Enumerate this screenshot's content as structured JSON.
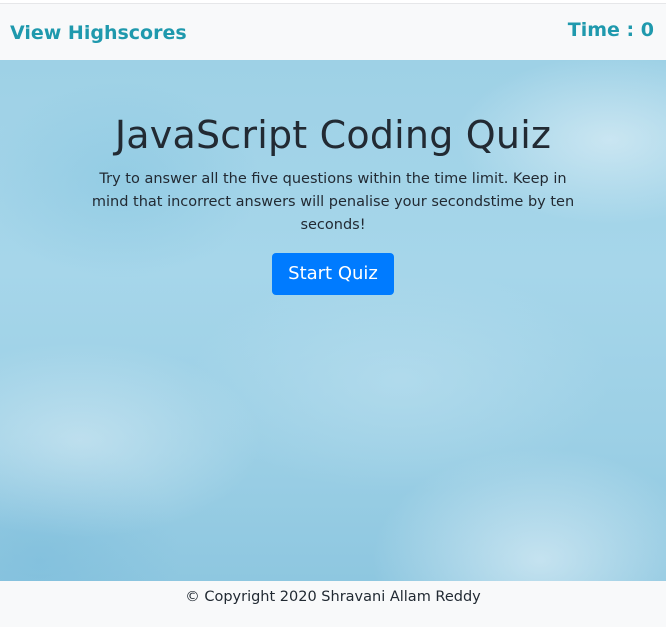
{
  "header": {
    "highscores_link": "View Highscores",
    "time_label": "Time :",
    "time_value": "0"
  },
  "main": {
    "title": "JavaScript Coding Quiz",
    "description": "Try to answer all the five questions within the time limit. Keep in mind that incorrect answers will penalise your secondstime by ten seconds!",
    "start_button": "Start Quiz"
  },
  "footer": {
    "copyright": "© Copyright 2020 Shravani Allam Reddy"
  },
  "colors": {
    "accent": "#1f99ad",
    "button": "#007bff",
    "bar_background": "#f8f9fa",
    "hero_background": "#a6d6ea"
  }
}
